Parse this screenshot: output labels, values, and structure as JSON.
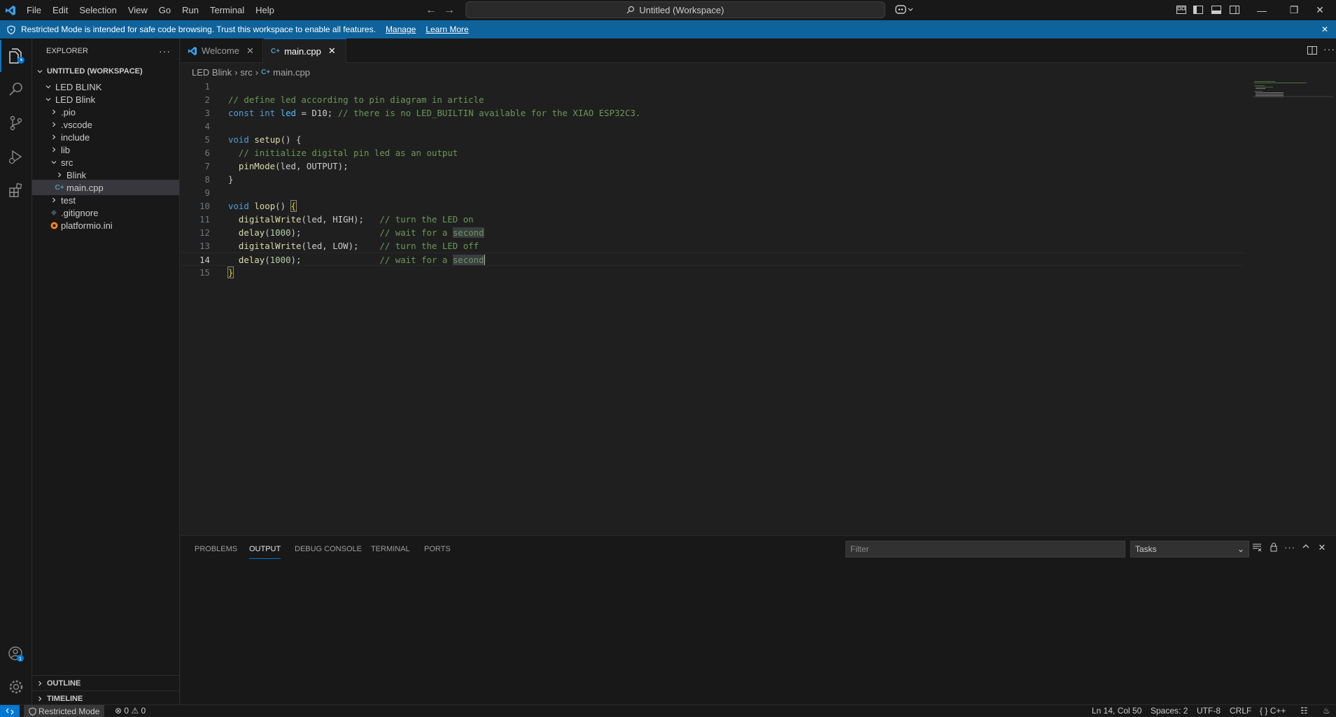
{
  "titlebar": {
    "menu": [
      "File",
      "Edit",
      "Selection",
      "View",
      "Go",
      "Run",
      "Terminal",
      "Help"
    ],
    "command_center": "Untitled (Workspace)"
  },
  "banner": {
    "message": "Restricted Mode is intended for safe code browsing. Trust this workspace to enable all features.",
    "manage": "Manage",
    "learn_more": "Learn More"
  },
  "sidebar": {
    "title": "EXPLORER",
    "workspace": "UNTITLED (WORKSPACE)",
    "root_folder": "LED BLINK",
    "project": "LED Blink",
    "items": [
      ".pio",
      ".vscode",
      "include",
      "lib",
      "src",
      "Blink",
      "main.cpp",
      "test",
      ".gitignore",
      "platformio.ini"
    ],
    "outline": "OUTLINE",
    "timeline": "TIMELINE"
  },
  "tabs": [
    {
      "label": "Welcome"
    },
    {
      "label": "main.cpp"
    }
  ],
  "breadcrumb": [
    "LED Blink",
    "src",
    "main.cpp"
  ],
  "editor": {
    "line_numbers": [
      "1",
      "2",
      "3",
      "4",
      "5",
      "6",
      "7",
      "8",
      "9",
      "10",
      "11",
      "12",
      "13",
      "14",
      "15"
    ],
    "current_line": 14
  },
  "panel": {
    "tabs": [
      "PROBLEMS",
      "OUTPUT",
      "DEBUG CONSOLE",
      "TERMINAL",
      "PORTS"
    ],
    "filter_placeholder": "Filter",
    "task_select": "Tasks"
  },
  "status": {
    "restricted": "Restricted Mode",
    "errors": "0",
    "warnings": "0",
    "position": "Ln 14, Col 50",
    "spaces": "Spaces: 2",
    "encoding": "UTF-8",
    "eol": "CRLF",
    "language": "C++"
  },
  "colors": {
    "accent": "#0078d4",
    "banner": "#0e639c",
    "keyword": "#569cd6",
    "function": "#dcdcaa",
    "comment": "#6a9955",
    "number": "#b5cea8"
  }
}
